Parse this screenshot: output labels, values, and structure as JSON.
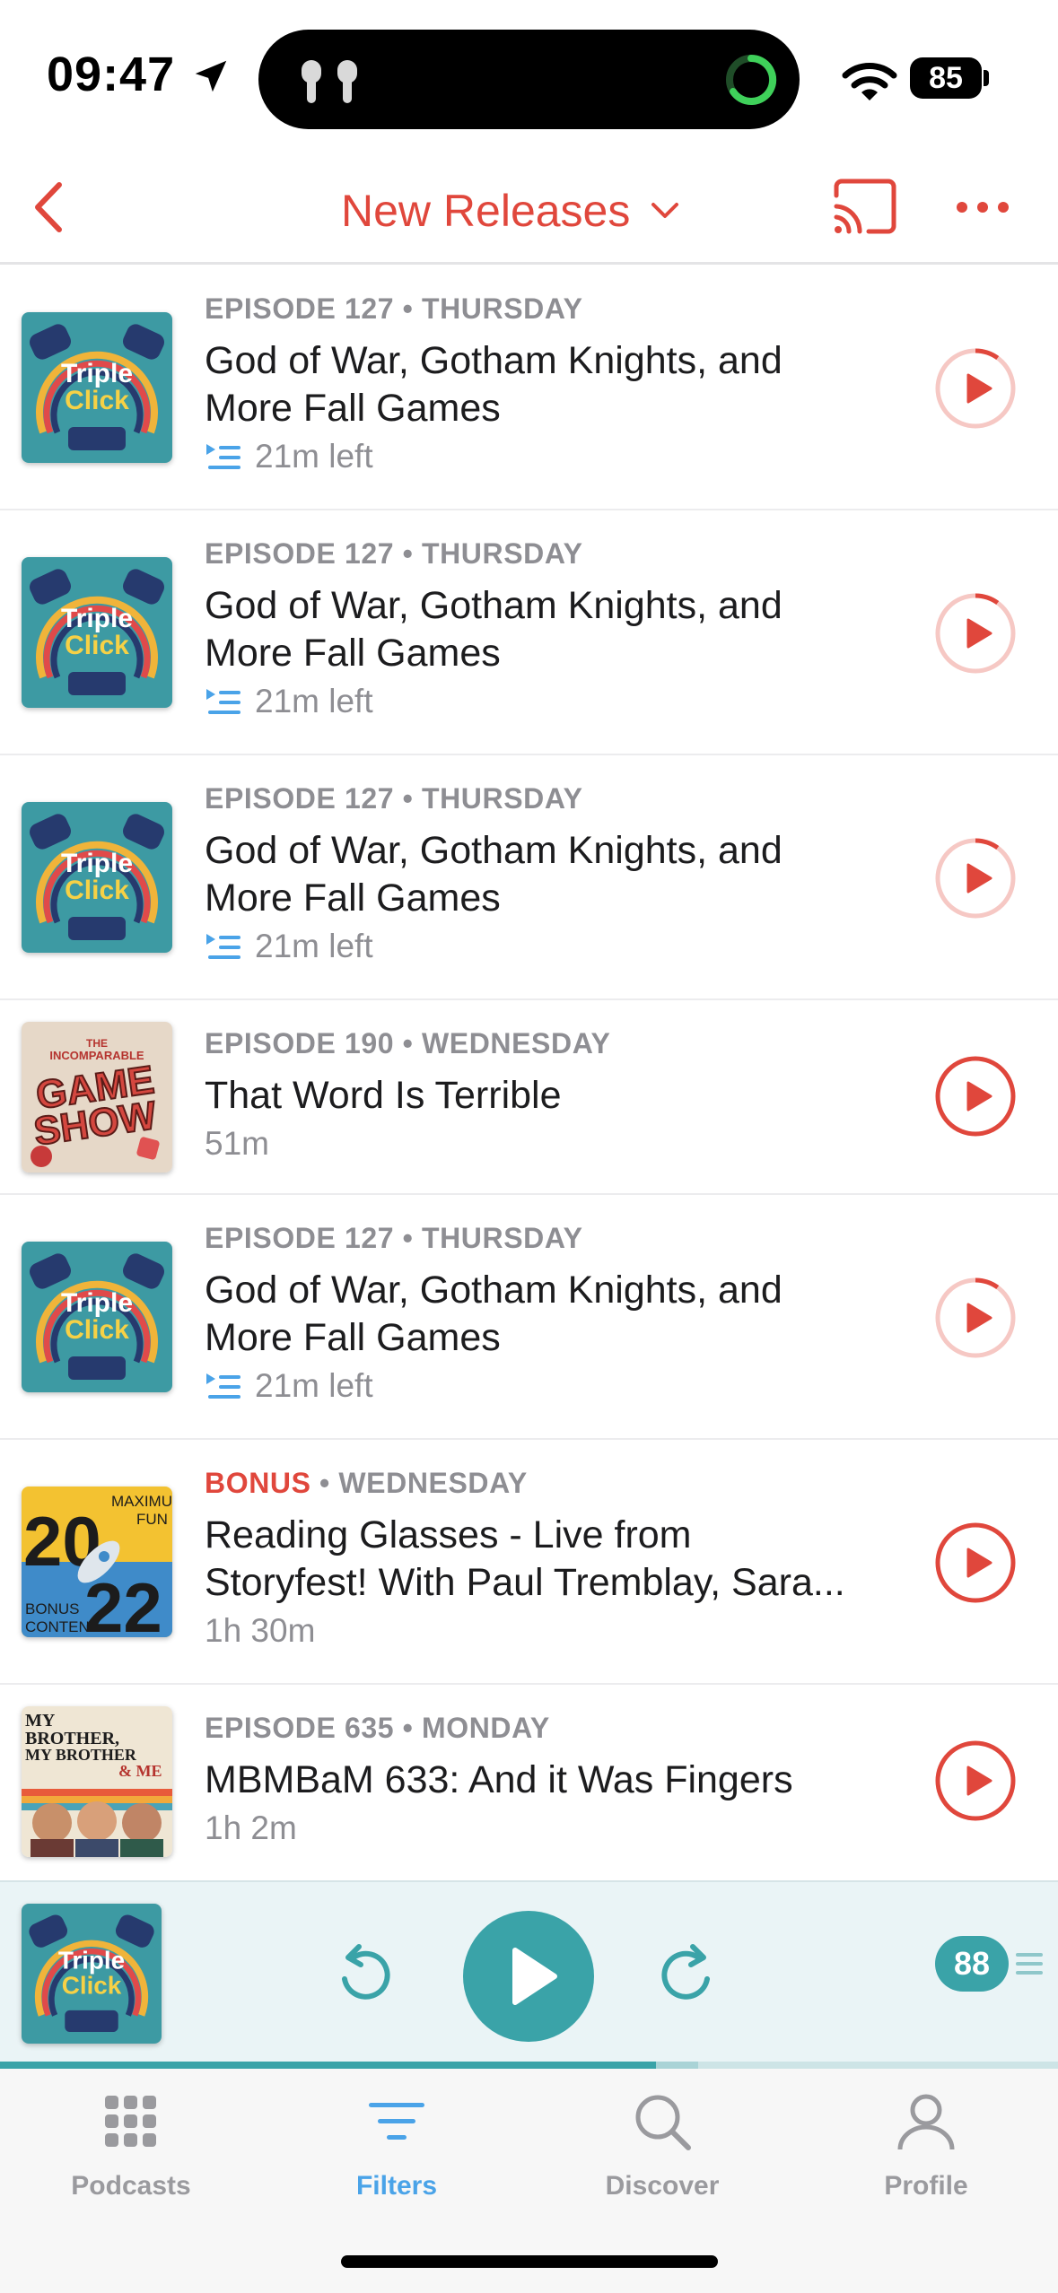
{
  "status_bar": {
    "time": "09:47",
    "battery": "85"
  },
  "nav": {
    "title": "New Releases"
  },
  "episodes": [
    {
      "meta_prefix": "EPISODE 127",
      "sep": " • ",
      "day": "THURSDAY",
      "title": "God of War, Gotham Knights, and",
      "title2": "More Fall Games",
      "sub": "21m left",
      "in_progress": true,
      "art": "triple-click",
      "progress": 0.1
    },
    {
      "meta_prefix": "EPISODE 127",
      "sep": " • ",
      "day": "THURSDAY",
      "title": "God of War, Gotham Knights, and",
      "title2": "More Fall Games",
      "sub": "21m left",
      "in_progress": true,
      "art": "triple-click",
      "progress": 0.1
    },
    {
      "meta_prefix": "EPISODE 127",
      "sep": " • ",
      "day": "THURSDAY",
      "title": "God of War, Gotham Knights, and",
      "title2": "More Fall Games",
      "sub": "21m left",
      "in_progress": true,
      "art": "triple-click",
      "progress": 0.1
    },
    {
      "meta_prefix": "EPISODE 190",
      "sep": " • ",
      "day": "WEDNESDAY",
      "title": "That Word Is Terrible",
      "title2": "",
      "sub": "51m",
      "in_progress": false,
      "art": "game-show",
      "art_text_top": "THE",
      "art_text_mid": "INCOMPARABLE",
      "art_text_main1": "GAME",
      "art_text_main2": "SHOW"
    },
    {
      "meta_prefix": "EPISODE 127",
      "sep": " • ",
      "day": "THURSDAY",
      "title": "God of War, Gotham Knights, and",
      "title2": "More Fall Games",
      "sub": "21m left",
      "in_progress": true,
      "art": "triple-click",
      "progress": 0.1
    },
    {
      "meta_prefix": "BONUS",
      "sep": " • ",
      "day": "WEDNESDAY",
      "title": "Reading Glasses - Live from",
      "title2": "Storyfest! With Paul Tremblay, Sara...",
      "sub": "1h 30m",
      "in_progress": false,
      "art": "maxfun",
      "art_text_a": "MAXIMUM",
      "art_text_b": "FUN",
      "art_text_c": "BONUS",
      "art_text_d": "CONTENT",
      "art_year_a": "20",
      "art_year_b": "22"
    },
    {
      "meta_prefix": "EPISODE 635",
      "sep": " • ",
      "day": "MONDAY",
      "title": "MBMBaM 633: And it Was Fingers",
      "title2": "",
      "sub": "1h 2m",
      "in_progress": false,
      "art": "mbmbam",
      "art_text_a": "MY",
      "art_text_b": "BROTHER,",
      "art_text_c": "MY BROTHER",
      "art_text_d": "& ME"
    }
  ],
  "art_label": {
    "line1": "Triple",
    "line2": "Click"
  },
  "mini_player": {
    "speed": "88",
    "progress": 0.62,
    "buffered": 0.66
  },
  "tabs": [
    {
      "label": "Podcasts"
    },
    {
      "label": "Filters"
    },
    {
      "label": "Discover"
    },
    {
      "label": "Profile"
    }
  ],
  "colors": {
    "accent": "#e0473c",
    "teal": "#3aa3a8",
    "tab_active": "#4aa3e8",
    "meta_gray": "#8e8e93"
  }
}
